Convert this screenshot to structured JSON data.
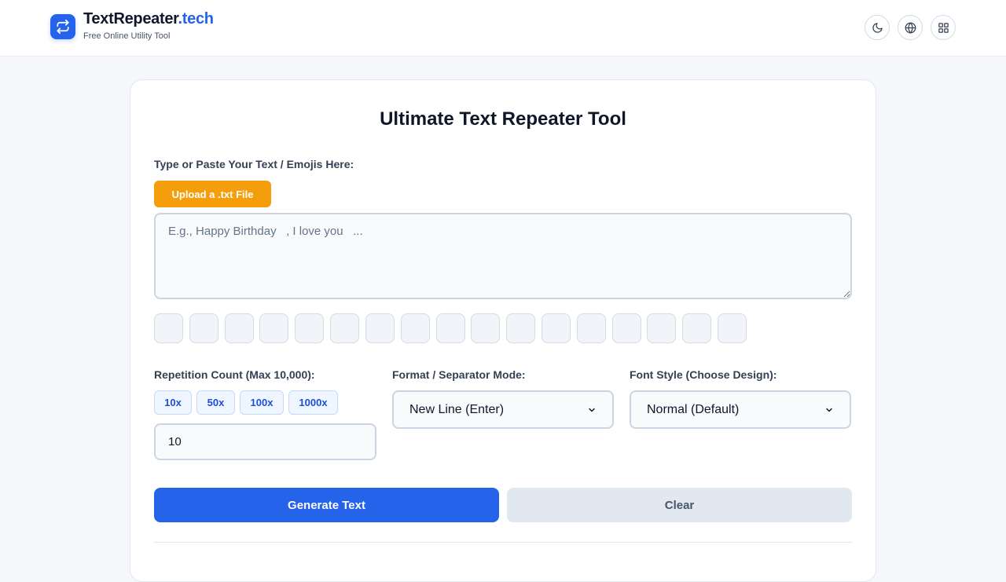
{
  "header": {
    "logo_icon": "repeat-arrows-icon",
    "brand_main": "TextRepeater",
    "brand_accent": ".tech",
    "tagline": "Free Online Utility Tool",
    "actions": [
      "moon-icon",
      "globe-icon",
      "grid-icon"
    ]
  },
  "tool": {
    "title": "Ultimate Text Repeater Tool",
    "text_label": "Type or Paste Your Text / Emojis Here:",
    "upload_label": "Upload a .txt File",
    "textarea_placeholder": "E.g., Happy Birthday   , I love you   ...",
    "textarea_value": "",
    "emoji_buttons_count": 17,
    "repetition_label": "Repetition Count (Max 10,000):",
    "quick_counts": [
      "10x",
      "50x",
      "100x",
      "1000x"
    ],
    "count_value": "10",
    "format_label": "Format / Separator Mode:",
    "format_selected": "New Line (Enter)",
    "font_label": "Font Style (Choose Design):",
    "font_selected": "Normal (Default)",
    "generate_label": "Generate Text",
    "clear_label": "Clear"
  },
  "colors": {
    "primary": "#2563eb",
    "upload": "#f59e0b",
    "clear_bg": "#e2e8f0",
    "page_bg": "#f5f7fa"
  }
}
